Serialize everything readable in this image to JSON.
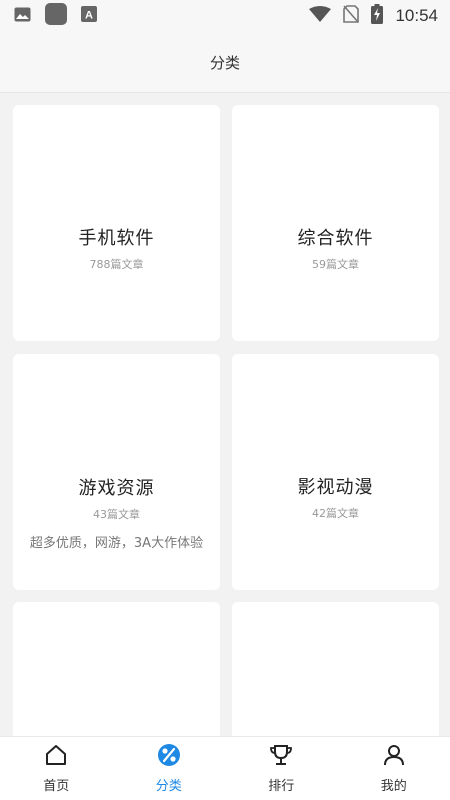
{
  "status_bar": {
    "time": "10:54",
    "left_icons": [
      "image-icon",
      "app-square-icon",
      "font-icon"
    ],
    "right_icons": [
      "wifi-icon",
      "no-sim-icon",
      "battery-charging-icon"
    ]
  },
  "header": {
    "title": "分类"
  },
  "categories": [
    {
      "title": "手机软件",
      "count": "788篇文章",
      "desc": ""
    },
    {
      "title": "综合软件",
      "count": "59篇文章",
      "desc": ""
    },
    {
      "title": "游戏资源",
      "count": "43篇文章",
      "desc": "超多优质，网游，3A大作体验"
    },
    {
      "title": "影视动漫",
      "count": "42篇文章",
      "desc": ""
    },
    {
      "title": "",
      "count": "",
      "desc": ""
    },
    {
      "title": "",
      "count": "",
      "desc": ""
    }
  ],
  "bottom_nav": [
    {
      "label": "首页",
      "icon": "home-icon",
      "active": false
    },
    {
      "label": "分类",
      "icon": "category-icon",
      "active": true
    },
    {
      "label": "排行",
      "icon": "trophy-icon",
      "active": false
    },
    {
      "label": "我的",
      "icon": "user-icon",
      "active": false
    }
  ],
  "colors": {
    "accent": "#1e88e5",
    "background": "#f2f2f2",
    "card": "#ffffff"
  }
}
